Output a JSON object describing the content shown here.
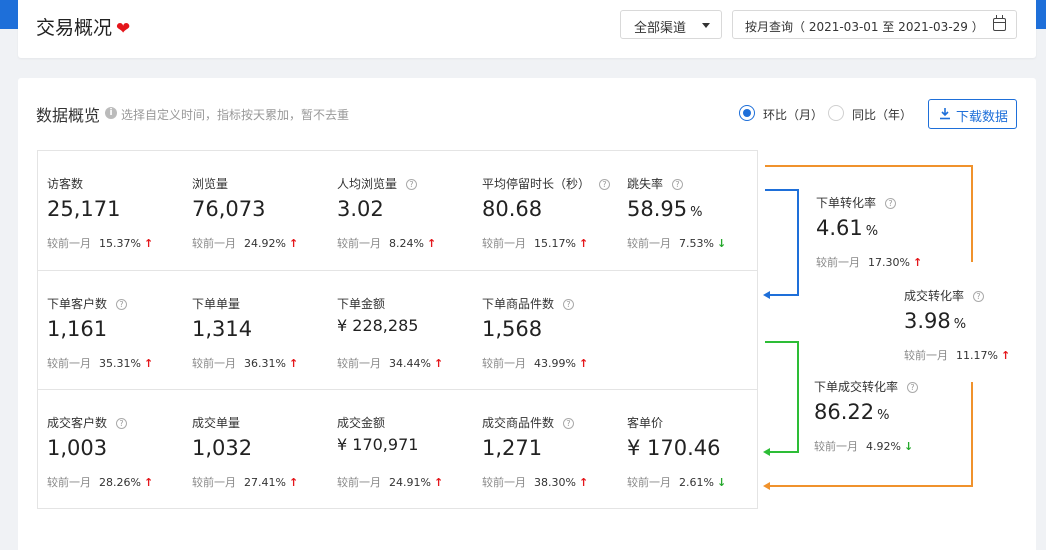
{
  "header": {
    "title": "交易概况",
    "channel_select": "全部渠道",
    "date_range": "按月查询（ 2021-03-01 至 2021-03-29 ）"
  },
  "overview": {
    "title": "数据概览",
    "hint": "选择自定义时间，指标按天累加，暂不去重",
    "radio_mom": "环比（月）",
    "radio_yoy": "同比（年）",
    "download": "下载数据",
    "compare_label": "较前一月"
  },
  "metrics": {
    "visitors": {
      "label": "访客数",
      "value": "25,171",
      "change": "15.37%"
    },
    "pageviews": {
      "label": "浏览量",
      "value": "76,073",
      "change": "24.92%"
    },
    "per_capita": {
      "label": "人均浏览量",
      "value": "3.02",
      "change": "8.24%"
    },
    "avg_stay": {
      "label": "平均停留时长（秒）",
      "value": "80.68",
      "change": "15.17%"
    },
    "bounce": {
      "label": "跳失率",
      "value": "58.95",
      "unit": "%",
      "change": "7.53%"
    },
    "order_customers": {
      "label": "下单客户数",
      "value": "1,161",
      "change": "35.31%"
    },
    "order_count": {
      "label": "下单单量",
      "value": "1,314",
      "change": "36.31%"
    },
    "order_amount": {
      "label": "下单金额",
      "value": "¥ 228,285",
      "change": "34.44%"
    },
    "order_items": {
      "label": "下单商品件数",
      "value": "1,568",
      "change": "43.99%"
    },
    "deal_customers": {
      "label": "成交客户数",
      "value": "1,003",
      "change": "28.26%"
    },
    "deal_count": {
      "label": "成交单量",
      "value": "1,032",
      "change": "27.41%"
    },
    "deal_amount": {
      "label": "成交金额",
      "value": "¥ 170,971",
      "change": "24.91%"
    },
    "deal_items": {
      "label": "成交商品件数",
      "value": "1,271",
      "change": "38.30%"
    },
    "avg_price": {
      "label": "客单价",
      "value": "¥ 170.46",
      "change": "2.61%"
    }
  },
  "conversion": {
    "order_rate": {
      "label": "下单转化率",
      "value": "4.61",
      "unit": "%",
      "change": "17.30%"
    },
    "deal_rate": {
      "label": "成交转化率",
      "value": "3.98",
      "unit": "%",
      "change": "11.17%"
    },
    "order_deal_rate": {
      "label": "下单成交转化率",
      "value": "86.22",
      "unit": "%",
      "change": "4.92%"
    }
  },
  "colors": {
    "accent": "#1e6fd9",
    "up": "#e4161b",
    "down": "#25a82c",
    "flow_blue": "#1e6fd9",
    "flow_green": "#2dbd36",
    "flow_orange": "#f0922c"
  }
}
